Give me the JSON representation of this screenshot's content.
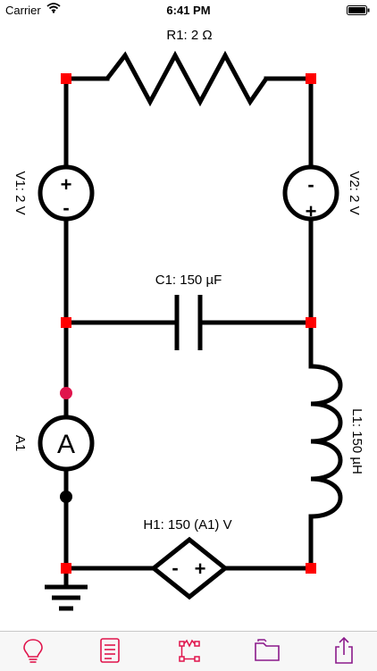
{
  "status_bar": {
    "carrier": "Carrier",
    "time": "6:41 PM"
  },
  "circuit": {
    "resistor_label": "R1: 2 Ω",
    "capacitor_label": "C1: 150 µF",
    "inductor_label": "L1: 150 µH",
    "source_v1_label": "V1: 2 V",
    "source_v2_label": "V2: 2 V",
    "ammeter_label": "A1",
    "ammeter_symbol": "A",
    "dependent_source_label": "H1: 150 (A1) V",
    "colors": {
      "wire": "#000000",
      "node": "#ff0000",
      "accent": "#e0144c",
      "toolbar_purple": "#8b1a8b"
    }
  },
  "toolbar": {
    "items": [
      {
        "icon": "lightbulb-icon"
      },
      {
        "icon": "notes-icon"
      },
      {
        "icon": "circuit-editor-icon"
      },
      {
        "icon": "folder-icon"
      },
      {
        "icon": "share-icon"
      }
    ]
  }
}
